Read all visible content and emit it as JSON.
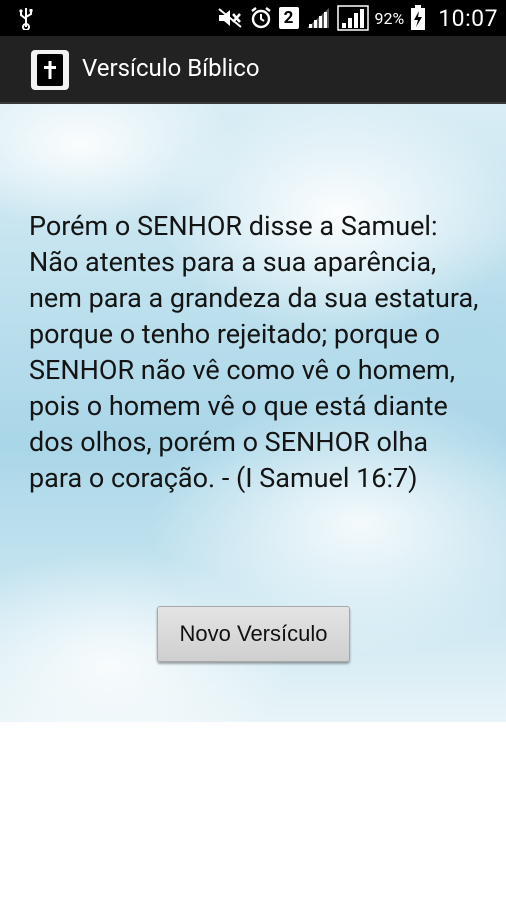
{
  "status_bar": {
    "notification_count": "2",
    "battery_percent": "92%",
    "time": "10:07",
    "icons": [
      "usb-icon",
      "mute-icon",
      "alarm-icon",
      "signal-icon",
      "signal-icon",
      "battery-charging-icon"
    ]
  },
  "action_bar": {
    "title": "Versículo Bíblico",
    "icon": "bible-icon"
  },
  "main": {
    "verse_text": "Porém o SENHOR disse a Samuel: Não atentes para a sua aparência, nem para a grandeza da sua estatura, porque o tenho rejeitado; porque o SENHOR não vê como vê o homem, pois o homem vê o que está diante dos olhos, porém o SENHOR olha para o coração. - (I Samuel 16:7)",
    "new_verse_button": "Novo Versículo"
  },
  "colors": {
    "status_bar_bg": "#000000",
    "action_bar_bg": "#222222",
    "sky_blue": "#a9d6e8"
  }
}
